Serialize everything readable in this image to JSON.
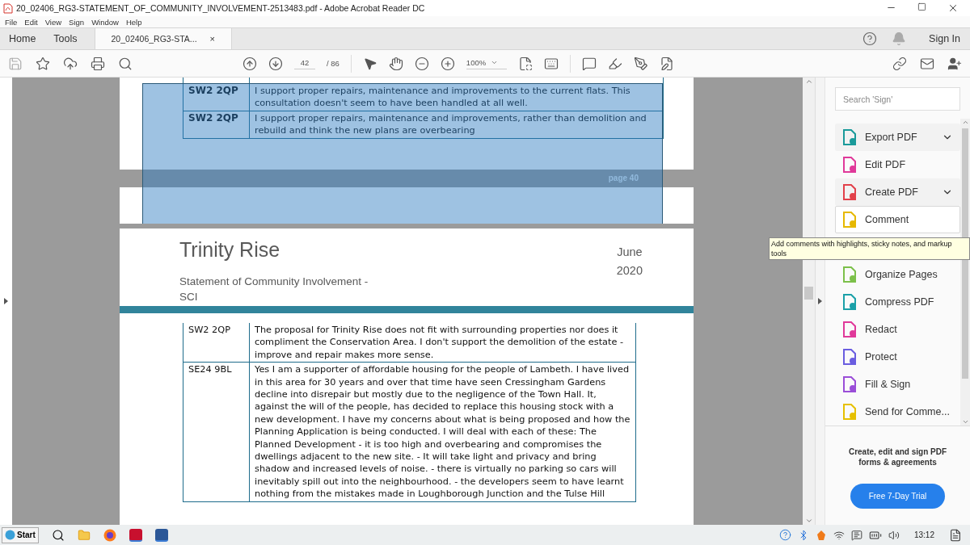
{
  "window": {
    "title": "20_02406_RG3-STATEMENT_OF_COMMUNITY_INVOLVEMENT-2513483.pdf - Adobe Acrobat Reader DC"
  },
  "menu": [
    "File",
    "Edit",
    "View",
    "Sign",
    "Window",
    "Help"
  ],
  "tabs": [
    {
      "label": "Home",
      "selected": false
    },
    {
      "label": "Tools",
      "selected": false
    },
    {
      "label": "20_02406_RG3-STA...",
      "selected": true,
      "close": "×"
    }
  ],
  "account": {
    "sign_in": "Sign In"
  },
  "toolbar": {
    "page": "42",
    "page_total": "/ 86",
    "zoom": "100%"
  },
  "previous_page": {
    "selected": true,
    "footer": "page 40",
    "rows": [
      {
        "postcode": "SW2 2QP",
        "comment": "I support proper repairs, maintenance and improvements to the current flats. This consultation doesn't seem to have been handled at all well."
      },
      {
        "postcode": "SW2 2QP",
        "comment": "I support proper repairs, maintenance and improvements, rather than demolition and rebuild and think the new plans are overbearing"
      }
    ]
  },
  "current_page": {
    "title": "Trinity Rise",
    "date_line_1": "June",
    "date_line_2": "2020",
    "subtitle_line_1": "Statement of Community Involvement -",
    "subtitle_line_2": "SCI",
    "rows": [
      {
        "postcode": "SW2 2QP",
        "comment": "The proposal for Trinity Rise does not fit with surrounding properties nor does it compliment the Conservation Area. I don't support the demolition of the estate - improve and repair makes more sense."
      },
      {
        "postcode": "SE24 9BL",
        "comment": "Yes I am a supporter of affordable housing for the people of Lambeth. I have lived in this area for 30 years and over that time have seen Cressingham Gardens decline into disrepair but mostly due to the negligence of the Town Hall. It, against the will of the people, has decided to replace this housing stock with a new development. I have my concerns about what is being proposed and how the Planning Application is being conducted. I will deal with each of these: The Planned Development - it is too high and overbearing and compromises the dwellings adjacent to the new site. - It will take light and privacy and bring shadow and increased levels of noise. - there is virtually no parking so cars will inevitably spill out into the neighbourhood. - the developers seem to have learnt nothing from the mistakes made in Loughborough Junction and the Tulse Hill"
      }
    ]
  },
  "right_panel": {
    "search": {
      "placeholder": "Search 'Sign'"
    },
    "tools": [
      {
        "label": "Export PDF",
        "kind": "dropdown",
        "selected": false,
        "color": "#1a9a9a"
      },
      {
        "label": "Edit PDF",
        "kind": "plain",
        "selected": false,
        "color": "#e0399a"
      },
      {
        "label": "Create PDF",
        "kind": "dropdown",
        "selected": false,
        "color": "#e2404a"
      },
      {
        "label": "Comment",
        "kind": "plain",
        "selected": true,
        "color": "#e6b800"
      },
      {
        "label": "Organize Pages",
        "kind": "plain",
        "selected": false,
        "color": "#7cc04a"
      },
      {
        "label": "Compress PDF",
        "kind": "plain",
        "selected": false,
        "color": "#1aa0a8"
      },
      {
        "label": "Redact",
        "kind": "plain",
        "selected": false,
        "color": "#e0399a"
      },
      {
        "label": "Protect",
        "kind": "plain",
        "selected": false,
        "color": "#6a5de0"
      },
      {
        "label": "Fill & Sign",
        "kind": "plain",
        "selected": false,
        "color": "#9a4ed8"
      },
      {
        "label": "Send for Comme...",
        "kind": "plain",
        "selected": false,
        "color": "#e6c000"
      }
    ],
    "promo": "Create, edit and sign PDF forms & agreements",
    "trial_button": "Free 7-Day Trial"
  },
  "tooltip": "Add comments with highlights, sticky notes, and markup tools",
  "taskbar": {
    "start": "Start",
    "time": "13:12"
  }
}
